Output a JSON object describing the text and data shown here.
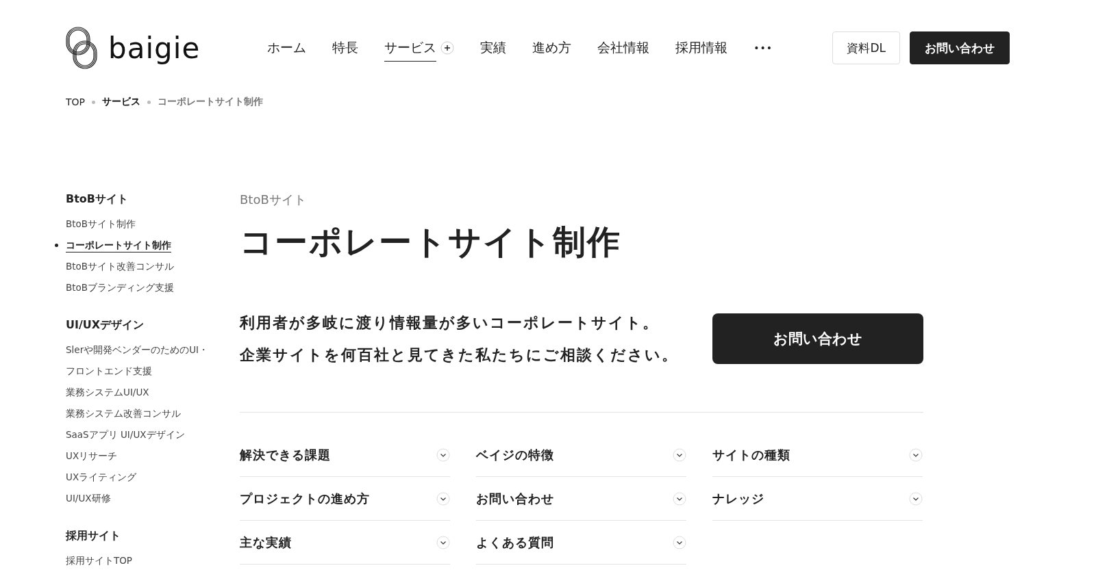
{
  "header": {
    "logo_text": "baigie",
    "nav": [
      {
        "label": "ホーム",
        "selected": false,
        "has_submenu": false
      },
      {
        "label": "特長",
        "selected": false,
        "has_submenu": false
      },
      {
        "label": "サービス",
        "selected": true,
        "has_submenu": true
      },
      {
        "label": "実績",
        "selected": false,
        "has_submenu": false
      },
      {
        "label": "進め方",
        "selected": false,
        "has_submenu": false
      },
      {
        "label": "会社情報",
        "selected": false,
        "has_submenu": false
      },
      {
        "label": "採用情報",
        "selected": false,
        "has_submenu": false
      }
    ],
    "more": "•••",
    "buttons": [
      {
        "label": "資料DL",
        "kind": "outline"
      },
      {
        "label": "お問い合わせ",
        "kind": "filled"
      }
    ]
  },
  "breadcrumb": [
    {
      "label": "TOP",
      "kind": "link"
    },
    {
      "label": "サービス",
      "kind": "parent"
    },
    {
      "label": "コーポレートサイト制作",
      "kind": "current"
    }
  ],
  "sidebar": {
    "groups": [
      {
        "heading": "BtoBサイト",
        "items": [
          {
            "label": "BtoBサイト制作",
            "selected": false
          },
          {
            "label": "コーポレートサイト制作",
            "selected": true
          },
          {
            "label": "BtoBサイト改善コンサル",
            "selected": false
          },
          {
            "label": "BtoBブランディング支援",
            "selected": false
          }
        ]
      },
      {
        "heading": "UI/UXデザイン",
        "items": [
          {
            "label": "Slerや開発ベンダーのためのUI・フロントエンド支援",
            "selected": false
          },
          {
            "label": "業務システムUI/UX",
            "selected": false
          },
          {
            "label": "業務システム改善コンサル",
            "selected": false
          },
          {
            "label": "SaaSアプリ UI/UXデザイン",
            "selected": false
          },
          {
            "label": "UXリサーチ",
            "selected": false
          },
          {
            "label": "UXライティング",
            "selected": false
          },
          {
            "label": "UI/UX研修",
            "selected": false
          }
        ]
      },
      {
        "heading": "採用サイト",
        "items": [
          {
            "label": "採用サイトTOP",
            "selected": false
          }
        ]
      }
    ]
  },
  "main": {
    "category": "BtoBサイト",
    "title": "コーポレートサイト制作",
    "lead": [
      "利用者が多岐に渡り情報量が多いコーポレートサイト。",
      "企業サイトを何百社と見てきた私たちにご相談ください。"
    ],
    "cta": "お問い合わせ",
    "anchors": [
      {
        "label": "解決できる課題",
        "expanded": false
      },
      {
        "label": "ベイジの特徴",
        "expanded": false
      },
      {
        "label": "サイトの種類",
        "expanded": false
      },
      {
        "label": "プロジェクトの進め方",
        "expanded": false
      },
      {
        "label": "お問い合わせ",
        "expanded": false
      },
      {
        "label": "ナレッジ",
        "expanded": false
      },
      {
        "label": "主な実績",
        "expanded": false
      },
      {
        "label": "よくある質問",
        "expanded": false
      }
    ]
  }
}
